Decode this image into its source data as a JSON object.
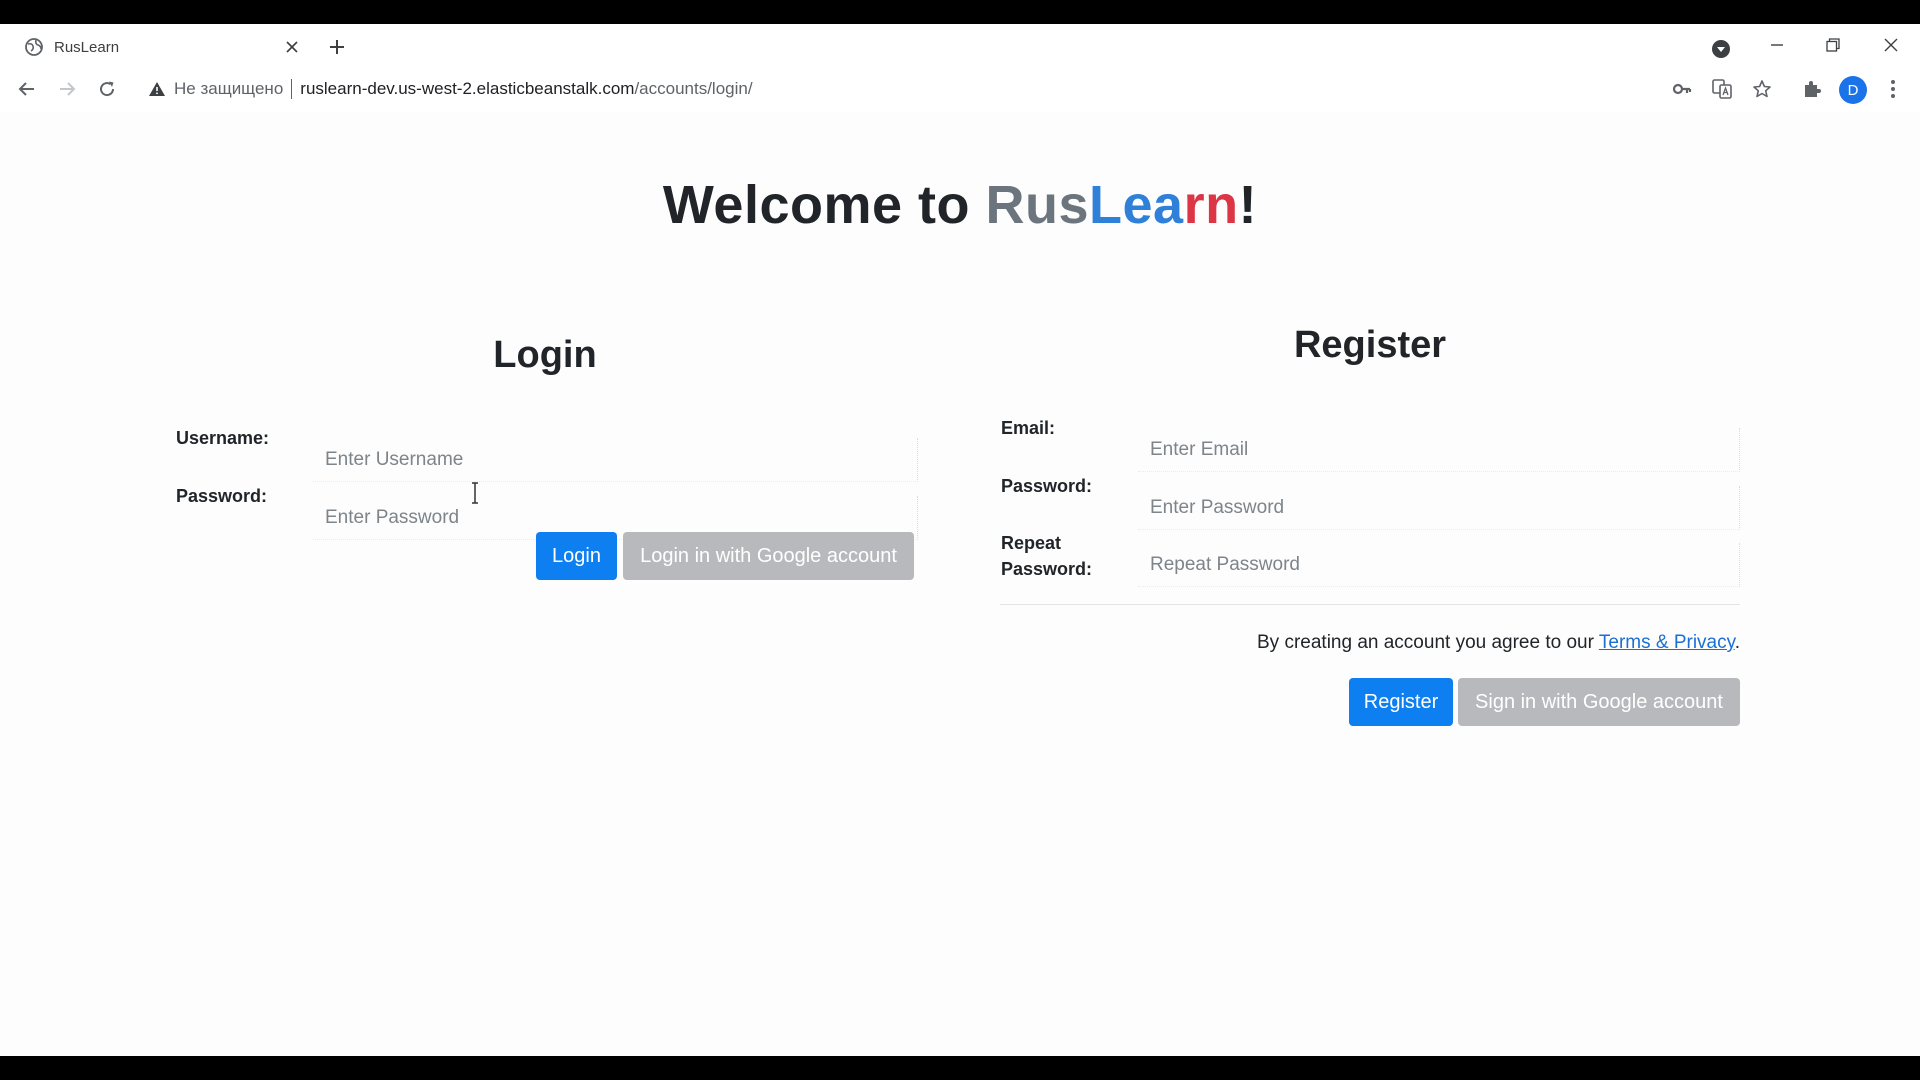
{
  "browser": {
    "tab_title": "RusLearn",
    "security_text": "Не защищено",
    "url_host": "ruslearn-dev.us-west-2.elasticbeanstalk.com",
    "url_path": "/accounts/login/",
    "profile_initial": "D"
  },
  "page": {
    "welcome_prefix": "Welcome to ",
    "brand_part1": "Rus",
    "brand_part2": "Lea",
    "brand_part3": "rn",
    "welcome_suffix": "!"
  },
  "login": {
    "title": "Login",
    "username_label": "Username:",
    "username_placeholder": "Enter Username",
    "password_label": "Password:",
    "password_placeholder": "Enter Password",
    "login_button": "Login",
    "google_button": "Login in with Google account"
  },
  "register": {
    "title": "Register",
    "email_label": "Email:",
    "email_placeholder": "Enter Email",
    "password_label": "Password:",
    "password_placeholder": "Enter Password",
    "repeat_label_line1": "Repeat",
    "repeat_label_line2": "Password:",
    "repeat_placeholder": "Repeat Password",
    "agree_prefix": "By creating an account you agree to our ",
    "terms_link": "Terms & Privacy",
    "agree_suffix": ".",
    "register_button": "Register",
    "google_button": "Sign in with Google account"
  },
  "colors": {
    "primary": "#0d7ff0",
    "secondary": "#b7b9bc",
    "brand_grey": "#6c757d",
    "brand_blue": "#2f80d8",
    "brand_red": "#dc3545"
  }
}
